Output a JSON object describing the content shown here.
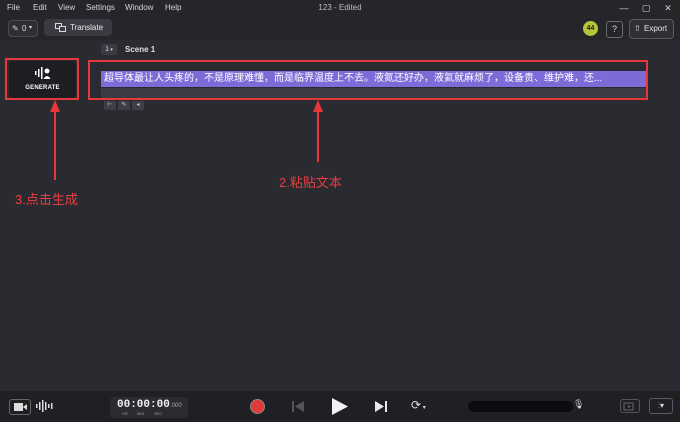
{
  "menu": {
    "items": [
      "File",
      "Edit",
      "View",
      "Settings",
      "Window",
      "Help"
    ]
  },
  "window": {
    "title": "123 - Edited"
  },
  "toolbar": {
    "pen_value": "0",
    "translate_label": "Translate",
    "avatar_text": "44",
    "help_label": "?",
    "export_label": "Export"
  },
  "scene": {
    "number": "1",
    "title": "Scene 1"
  },
  "generate": {
    "label": "GENERATE"
  },
  "script_text": "超导体最让人头疼的，不是原理难懂，而是临界温度上不去。液氮还好办，液氦就麻烦了，设备贵、维护难，还...",
  "annotations": {
    "paste_text": "2.粘贴文本",
    "click_generate": "3.点击生成"
  },
  "playback": {
    "time": "00:00:00",
    "ms": ".000",
    "units": [
      "HR",
      "MIN",
      "SEC"
    ]
  },
  "colors": {
    "accent": "#7f6bd8",
    "annotation_red": "#e6383b",
    "record_red": "#e03a3a"
  }
}
